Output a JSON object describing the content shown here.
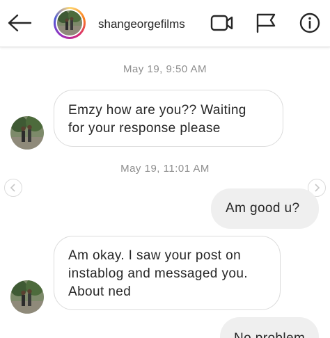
{
  "header": {
    "username": "shangeorgefilms",
    "icons": {
      "back": "back-arrow-icon",
      "video": "video-call-icon",
      "flag": "flag-icon",
      "info": "info-icon"
    },
    "story_ring_colors": [
      "#feda75",
      "#fa7e1e",
      "#d62976",
      "#962fbf",
      "#4f5bd5"
    ]
  },
  "messages": [
    {
      "type": "timestamp",
      "text": "May 19, 9:50 AM"
    },
    {
      "type": "received",
      "text_lines": [
        "Emzy how are you?? Waiting",
        "for your response please"
      ]
    },
    {
      "type": "timestamp",
      "text": "May 19, 11:01 AM"
    },
    {
      "type": "sent",
      "text": "Am good u?"
    },
    {
      "type": "received",
      "text_lines": [
        "Am okay. I saw your post on",
        "instablog and messaged you.",
        "About ned"
      ]
    },
    {
      "type": "sent",
      "text": "No problem"
    }
  ],
  "colors": {
    "sent_bubble": "#efefef",
    "received_border": "#dbdbdb",
    "timestamp_text": "#8e8e8e",
    "text": "#262626"
  }
}
